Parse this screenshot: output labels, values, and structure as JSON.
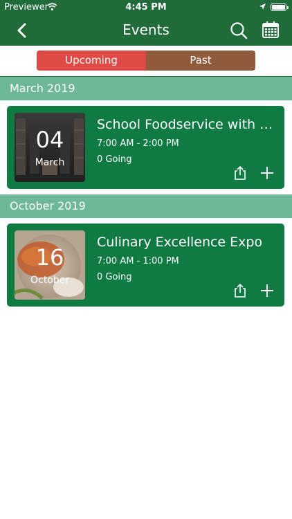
{
  "status_bar": {
    "carrier": "Previewer",
    "time": "4:45 PM"
  },
  "nav": {
    "title": "Events",
    "icons": [
      "back-chevron-icon",
      "search-icon",
      "calendar-icon"
    ]
  },
  "tabs": [
    {
      "label": "Upcoming",
      "selected": true,
      "color": "#e04a46"
    },
    {
      "label": "Past",
      "selected": false,
      "color": "#8e5b3b"
    }
  ],
  "sections": [
    {
      "header": "March 2019",
      "events": [
        {
          "day": "04",
          "month": "March",
          "title": "School Foodservice with a…",
          "time": "7:00 AM - 2:00 PM",
          "going": "0 Going"
        }
      ]
    },
    {
      "header": "October 2019",
      "events": [
        {
          "day": "16",
          "month": "October",
          "title": "Culinary Excellence Expo",
          "time": "7:00 AM - 1:00 PM",
          "going": "0 Going"
        }
      ]
    }
  ],
  "colors": {
    "nav_bg": "#1f6b3a",
    "section_bg": "#6db896",
    "card_bg": "#0f7b42"
  }
}
